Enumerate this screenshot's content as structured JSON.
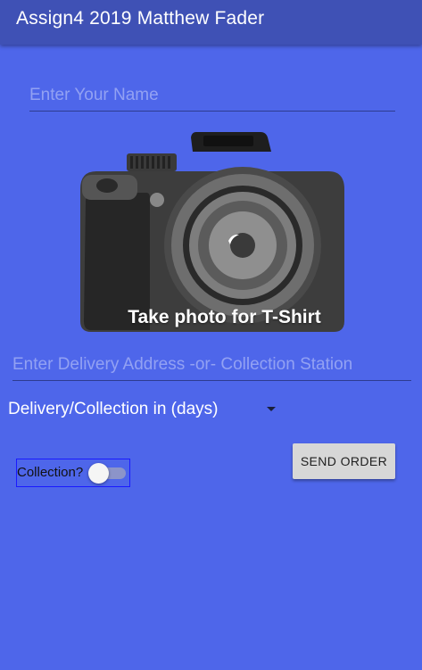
{
  "app_bar": {
    "title": "Assign4 2019 Matthew Fader"
  },
  "form": {
    "name_placeholder": "Enter Your Name",
    "address_placeholder": "Enter Delivery Address -or- Collection Station",
    "photo_caption": "Take photo for T-Shirt",
    "days_spinner_value": "Delivery/Collection in (days)",
    "send_button_label": "SEND ORDER",
    "collection_label": "Collection?",
    "collection_switch_on": false
  },
  "icons": {
    "camera": "camera-icon",
    "dropdown": "dropdown-arrow-icon"
  },
  "colors": {
    "app_bar": "#3f51b5",
    "background": "#4e66ea",
    "button": "#d7d7d7"
  }
}
